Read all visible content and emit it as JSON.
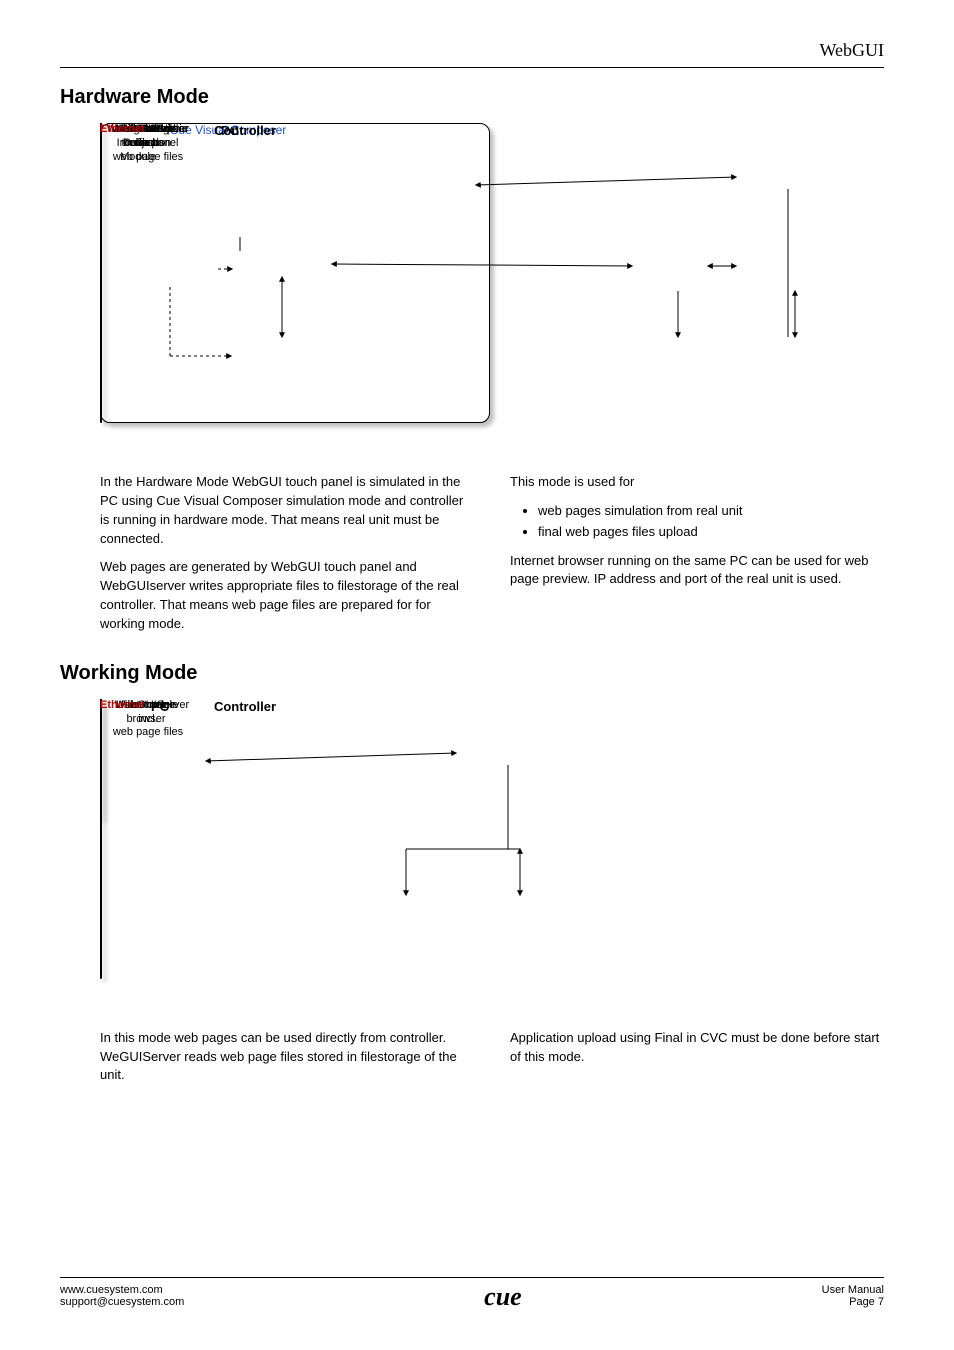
{
  "header": {
    "title": "WebGUI"
  },
  "section1": {
    "title": "Hardware Mode",
    "diagram": {
      "pc": {
        "title": "PC",
        "cvc": "Cue Visual Composer",
        "touchpanel": "WebGUI\ntouch panel",
        "graphic": "WebGUIGraphic\nCollection",
        "builder": "WebGUIBuilder",
        "pages": "Pages incl.\nobjects",
        "browser": "Internet\nbrowser"
      },
      "controller": {
        "title": "Controller",
        "server": "WebGUIServer",
        "iface": "WebGUI\nInterface\nModule",
        "filestorage": "Filestorage\nincl.\nweb page files",
        "usermodule": "User module"
      },
      "ethernet": "Ethernet"
    },
    "col1": {
      "p1": "In the Hardware Mode WebGUI touch panel is simulated in the PC using Cue Visual Composer simulation mode and controller is running in hardware mode. That means real unit must be connected.",
      "p2": "Web pages are generated by WebGUI touch panel and WebGUIserver writes appropriate files to filestorage of the real controller. That means web page files are prepared for for working mode."
    },
    "col2": {
      "p1": "This mode is used for",
      "b1": "web pages simulation from real unit",
      "b2": "final web pages files upload",
      "p2": "Internet browser running on the same PC can be used for web page preview. IP address and port of the real unit is used."
    }
  },
  "section2": {
    "title": "Working Mode",
    "diagram": {
      "pc": {
        "title": "PC",
        "browser": "Internet\nbrowser"
      },
      "controller": {
        "title": "Controller",
        "server": "WebGUIServer",
        "filestorage": "Filestorage\nincl.\nweb page files",
        "usermodule": "User module"
      },
      "ethernet": "Ethernet"
    },
    "col1": {
      "p1": "In this mode web pages can be used directly from controller. WeGUIServer reads web page files stored in filestorage of the unit."
    },
    "col2": {
      "p1": "Application upload using Final in CVC must be done before start of this mode."
    }
  },
  "footer": {
    "url": "www.cuesystem.com",
    "email": "support@cuesystem.com",
    "logo": "cue",
    "manual": "User Manual",
    "page": "Page 7"
  }
}
